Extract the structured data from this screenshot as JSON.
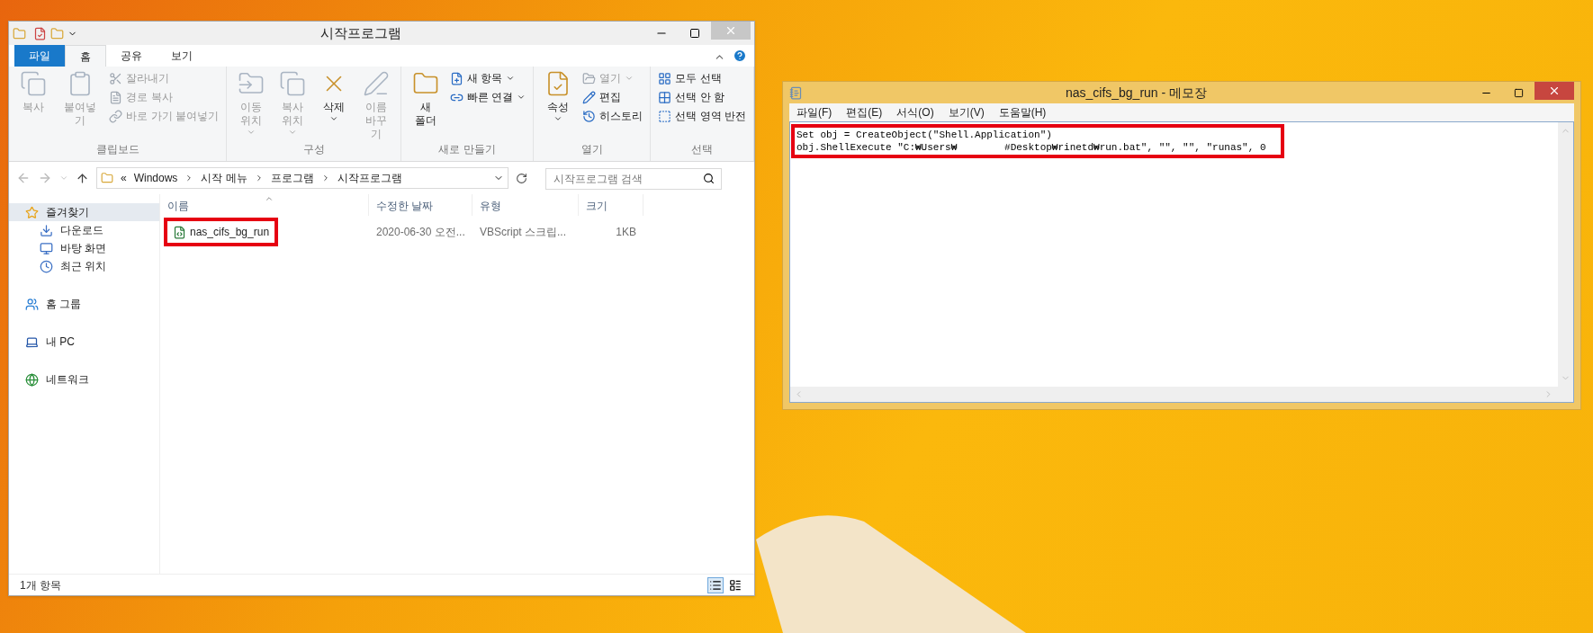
{
  "explorer": {
    "title": "시작프로그램",
    "tabs": [
      {
        "label": "파일",
        "kind": "file",
        "selected": false
      },
      {
        "label": "홈",
        "kind": "tab",
        "selected": true
      },
      {
        "label": "공유",
        "kind": "tab",
        "selected": false
      },
      {
        "label": "보기",
        "kind": "tab",
        "selected": false
      }
    ],
    "ribbon": [
      {
        "label": "클립보드",
        "items": [
          {
            "label": "복사",
            "kind": "large",
            "disabled": true,
            "dropdown": false
          },
          {
            "label": "붙여넣기",
            "kind": "large",
            "disabled": true,
            "dropdown": false
          },
          {
            "label": "잘라내기",
            "kind": "small",
            "disabled": true,
            "dropdown": false
          },
          {
            "label": "경로 복사",
            "kind": "small",
            "disabled": true,
            "dropdown": false
          },
          {
            "label": "바로 가기 붙여넣기",
            "kind": "small",
            "disabled": true,
            "dropdown": false
          }
        ]
      },
      {
        "label": "구성",
        "items": [
          {
            "label": "이동\n위치",
            "kind": "large",
            "disabled": true,
            "dropdown": true
          },
          {
            "label": "복사\n위치",
            "kind": "large",
            "disabled": true,
            "dropdown": true
          },
          {
            "label": "삭제",
            "kind": "large",
            "disabled": false,
            "dropdown": true
          },
          {
            "label": "이름\n바꾸기",
            "kind": "large",
            "disabled": true,
            "dropdown": false
          }
        ]
      },
      {
        "label": "새로 만들기",
        "items": [
          {
            "label": "새\n폴더",
            "kind": "large",
            "disabled": false,
            "dropdown": false
          },
          {
            "label": "새 항목",
            "kind": "small",
            "disabled": false,
            "dropdown": true
          },
          {
            "label": "빠른 연결",
            "kind": "small",
            "disabled": false,
            "dropdown": true
          }
        ]
      },
      {
        "label": "열기",
        "items": [
          {
            "label": "속성",
            "kind": "large",
            "disabled": false,
            "dropdown": true
          },
          {
            "label": "열기",
            "kind": "small",
            "disabled": true,
            "dropdown": true
          },
          {
            "label": "편집",
            "kind": "small",
            "disabled": false,
            "dropdown": false
          },
          {
            "label": "히스토리",
            "kind": "small",
            "disabled": false,
            "dropdown": false
          }
        ]
      },
      {
        "label": "선택",
        "items": [
          {
            "label": "모두 선택",
            "kind": "small",
            "disabled": false,
            "dropdown": false
          },
          {
            "label": "선택 안 함",
            "kind": "small",
            "disabled": false,
            "dropdown": false
          },
          {
            "label": "선택 영역 반전",
            "kind": "small",
            "disabled": false,
            "dropdown": false
          }
        ]
      }
    ],
    "address": {
      "prefix": "«",
      "segments": [
        "Windows",
        "시작 메뉴",
        "프로그램",
        "시작프로그램"
      ]
    },
    "search": {
      "placeholder": "시작프로그램 검색"
    },
    "sidebar": [
      {
        "label": "즐겨찾기",
        "selected": true,
        "children": [
          {
            "label": "다운로드",
            "selected": false
          },
          {
            "label": "바탕 화면",
            "selected": false
          },
          {
            "label": "최근 위치",
            "selected": false
          }
        ]
      },
      {
        "label": "홈 그룹",
        "selected": false
      },
      {
        "label": "내 PC",
        "selected": false
      },
      {
        "label": "네트워크",
        "selected": false
      }
    ],
    "columns": [
      {
        "label": "이름",
        "sorted": true
      },
      {
        "label": "수정한 날짜",
        "sorted": false
      },
      {
        "label": "유형",
        "sorted": false
      },
      {
        "label": "크기",
        "sorted": false
      }
    ],
    "rows": [
      {
        "name": "nas_cifs_bg_run",
        "date": "2020-06-30 오전...",
        "type": "VBScript 스크립...",
        "size": "1KB",
        "annotated": true
      }
    ],
    "status_bar": {
      "count": "1개 항목",
      "views": [
        {
          "kind": "details",
          "selected": true
        },
        {
          "kind": "tiles",
          "selected": false
        }
      ]
    }
  },
  "notepad": {
    "title": "nas_cifs_bg_run - 메모장",
    "menu": [
      "파일(F)",
      "편집(E)",
      "서식(O)",
      "보기(V)",
      "도움말(H)"
    ],
    "lines": [
      "Set obj = CreateObject(\"Shell.Application\")",
      "obj.ShellExecute \"C:₩Users₩        #Desktop₩rinetd₩run.bat\", \"\", \"\", \"runas\", 0"
    ],
    "annotated": true
  }
}
